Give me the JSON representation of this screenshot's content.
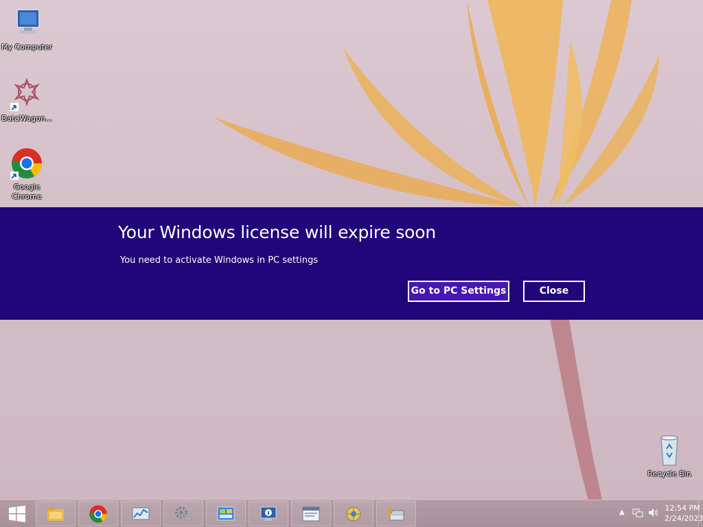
{
  "desktop": {
    "icons": [
      {
        "label": "My Computer",
        "icon": "computer-icon"
      },
      {
        "label": "DataWagon...",
        "icon": "datawagon-icon"
      },
      {
        "label": "Google\nChrome",
        "icon": "chrome-icon"
      },
      {
        "label": "Recycle Bin",
        "icon": "recycle-bin-icon"
      }
    ]
  },
  "notification": {
    "title": "Your Windows license will expire soon",
    "message": "You need to activate Windows in PC settings",
    "primary_button": "Go to PC Settings",
    "secondary_button": "Close",
    "background_color": "#20067a",
    "accent_color": "#4617b4"
  },
  "taskbar": {
    "start_icon": "windows-logo-icon",
    "pinned_apps": [
      {
        "name": "file-explorer-icon"
      },
      {
        "name": "chrome-icon"
      },
      {
        "name": "performance-monitor-icon"
      },
      {
        "name": "settings-gears-icon"
      },
      {
        "name": "control-panel-icon"
      },
      {
        "name": "system-info-icon"
      },
      {
        "name": "window-app-icon"
      },
      {
        "name": "globe-tool-icon"
      },
      {
        "name": "scanner-tool-icon"
      }
    ],
    "tray": {
      "show_hidden_icon": "chevron-up-icon",
      "network_icon": "network-icon",
      "volume_icon": "speaker-icon",
      "time": "12:54 PM",
      "date": "2/24/2023"
    }
  }
}
